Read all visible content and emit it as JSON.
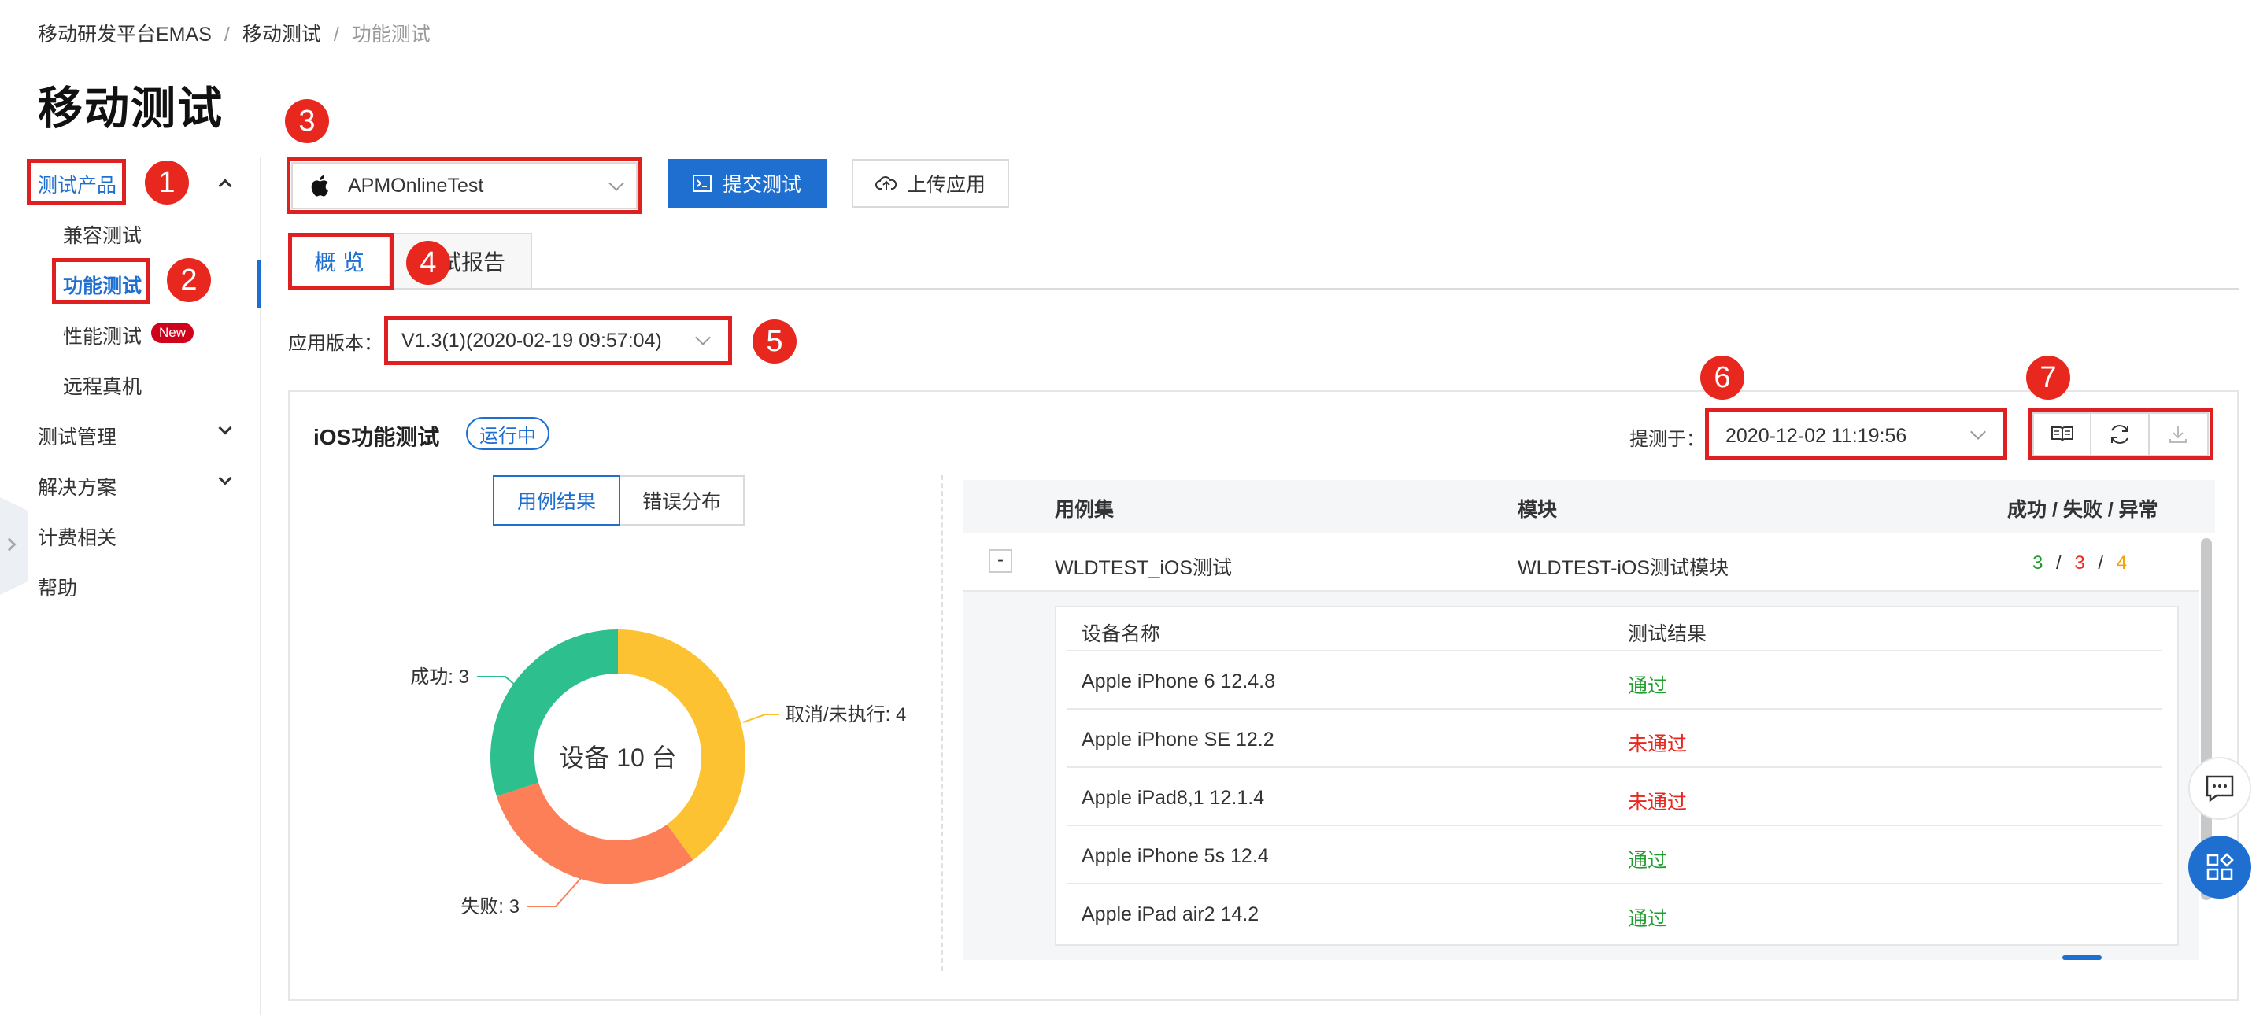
{
  "breadcrumb": {
    "items": [
      "移动研发平台EMAS",
      "移动测试",
      "功能测试"
    ],
    "separator": "/"
  },
  "page_title": "移动测试",
  "sidebar": {
    "groups": [
      {
        "label": "测试产品",
        "expanded": true,
        "active": true
      },
      {
        "label": "测试管理",
        "expanded": false
      },
      {
        "label": "解决方案",
        "expanded": false
      },
      {
        "label": "计费相关"
      },
      {
        "label": "帮助"
      }
    ],
    "sub_items": [
      {
        "label": "兼容测试"
      },
      {
        "label": "功能测试",
        "selected": true
      },
      {
        "label": "性能测试",
        "badge": "New"
      },
      {
        "label": "远程真机"
      }
    ]
  },
  "toolbar": {
    "app_select_value": "APMOnlineTest",
    "submit_label": "提交测试",
    "upload_label": "上传应用"
  },
  "tabs": [
    {
      "label": "概 览",
      "active": true
    },
    {
      "label": "测试报告",
      "visible_label": "试报告"
    }
  ],
  "version": {
    "label": "应用版本：",
    "value": "V1.3(1)(2020-02-19 09:57:04)"
  },
  "card": {
    "title": "iOS功能测试",
    "status": "运行中",
    "submitted_label": "提测于：",
    "submitted_value": "2020-12-02 11:19:56",
    "segments": [
      "用例结果",
      "错误分布"
    ]
  },
  "chart_data": {
    "type": "pie",
    "center_label": "设备 10 台",
    "slices": [
      {
        "label": "成功: 3",
        "value": 3,
        "color": "#2dbf8e"
      },
      {
        "label": "取消/未执行: 4",
        "value": 4,
        "color": "#fcc232"
      },
      {
        "label": "失败: 3",
        "value": 3,
        "color": "#fd7f57"
      }
    ]
  },
  "table": {
    "headers": [
      "用例集",
      "模块",
      "成功 / 失败 / 异常"
    ],
    "row": {
      "expand_symbol": "-",
      "suite": "WLDTEST_iOS测试",
      "module": "WLDTEST-iOS测试模块",
      "success": "3",
      "fail": "3",
      "error": "4",
      "sep": "/"
    },
    "sub_headers": [
      "设备名称",
      "测试结果"
    ],
    "devices": [
      {
        "name": "Apple iPhone 6 12.4.8",
        "result": "通过",
        "status": "ok"
      },
      {
        "name": "Apple iPhone SE 12.2",
        "result": "未通过",
        "status": "fail"
      },
      {
        "name": "Apple iPad8,1 12.1.4",
        "result": "未通过",
        "status": "fail"
      },
      {
        "name": "Apple iPhone 5s 12.4",
        "result": "通过",
        "status": "ok"
      },
      {
        "name": "Apple iPad air2 14.2",
        "result": "通过",
        "status": "ok"
      }
    ]
  },
  "markers": [
    "1",
    "2",
    "3",
    "4",
    "5",
    "6",
    "7"
  ],
  "colors": {
    "primary": "#1f6fd0",
    "annotation": "#e8271f",
    "success": "#1f9d2e",
    "fail": "#e8271f",
    "warning": "#f0a30a"
  }
}
